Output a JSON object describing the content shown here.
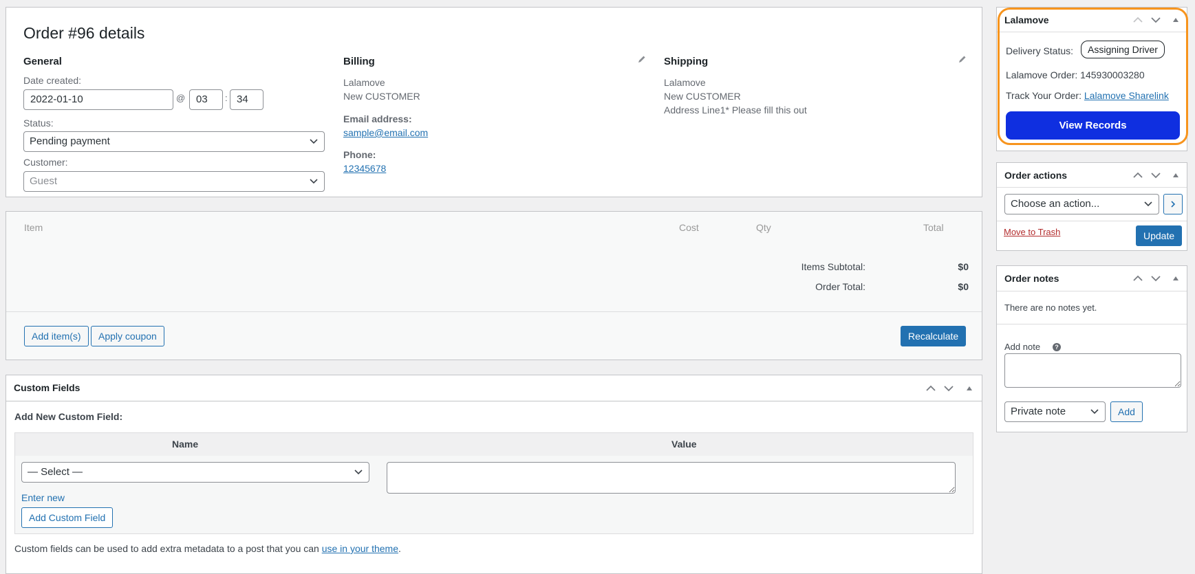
{
  "order": {
    "title": "Order #96 details",
    "general": {
      "heading": "General",
      "date_label": "Date created:",
      "date_value": "2022-01-10",
      "at_sep": "@",
      "hour_value": "03",
      "time_sep": ":",
      "minute_value": "34",
      "status_label": "Status:",
      "status_value": "Pending payment",
      "customer_label": "Customer:",
      "customer_value": "Guest"
    },
    "billing": {
      "heading": "Billing",
      "name_line1": "Lalamove",
      "name_line2": "New CUSTOMER",
      "email_label": "Email address:",
      "email_value": "sample@email.com",
      "phone_label": "Phone:",
      "phone_value": "12345678",
      "edit_icon": "pencil-icon"
    },
    "shipping": {
      "heading": "Shipping",
      "line1": "Lalamove",
      "line2": "New CUSTOMER",
      "line3": "Address Line1* Please fill this out",
      "edit_icon": "pencil-icon"
    }
  },
  "items": {
    "columns": [
      "Item",
      "Cost",
      "Qty",
      "Total"
    ],
    "subtotal_label": "Items Subtotal:",
    "subtotal_value": "$0",
    "total_label": "Order Total:",
    "total_value": "$0",
    "add_items_label": "Add item(s)",
    "apply_coupon_label": "Apply coupon",
    "recalculate_label": "Recalculate"
  },
  "custom_fields": {
    "title": "Custom Fields",
    "add_new_label": "Add New Custom Field:",
    "col_name": "Name",
    "col_value": "Value",
    "select_value": "— Select —",
    "enter_new_label": "Enter new",
    "add_button_label": "Add Custom Field",
    "footer_text": "Custom fields can be used to add extra metadata to a post that you can ",
    "footer_link": "use in your theme",
    "footer_end": "."
  },
  "lalamove": {
    "title": "Lalamove",
    "delivery_status_label": "Delivery Status:",
    "delivery_status_value": "Assigning Driver",
    "order_label": "Lalamove Order:",
    "order_value": "145930003280",
    "track_label": "Track Your Order:",
    "track_link": "Lalamove Sharelink",
    "view_records_label": "View Records",
    "highlight_color": "#f7941d",
    "button_color": "#0f2fe0"
  },
  "order_actions": {
    "title": "Order actions",
    "select_value": "Choose an action...",
    "go_icon": "chevron-right-icon",
    "trash_label": "Move to Trash",
    "update_label": "Update"
  },
  "order_notes": {
    "title": "Order notes",
    "empty_text": "There are no notes yet.",
    "add_note_label": "Add note",
    "help_icon": "?",
    "note_type_value": "Private note",
    "add_button_label": "Add"
  },
  "colors": {
    "accent": "#2271b1",
    "danger": "#b32d2e",
    "background": "#f0f0f1"
  }
}
